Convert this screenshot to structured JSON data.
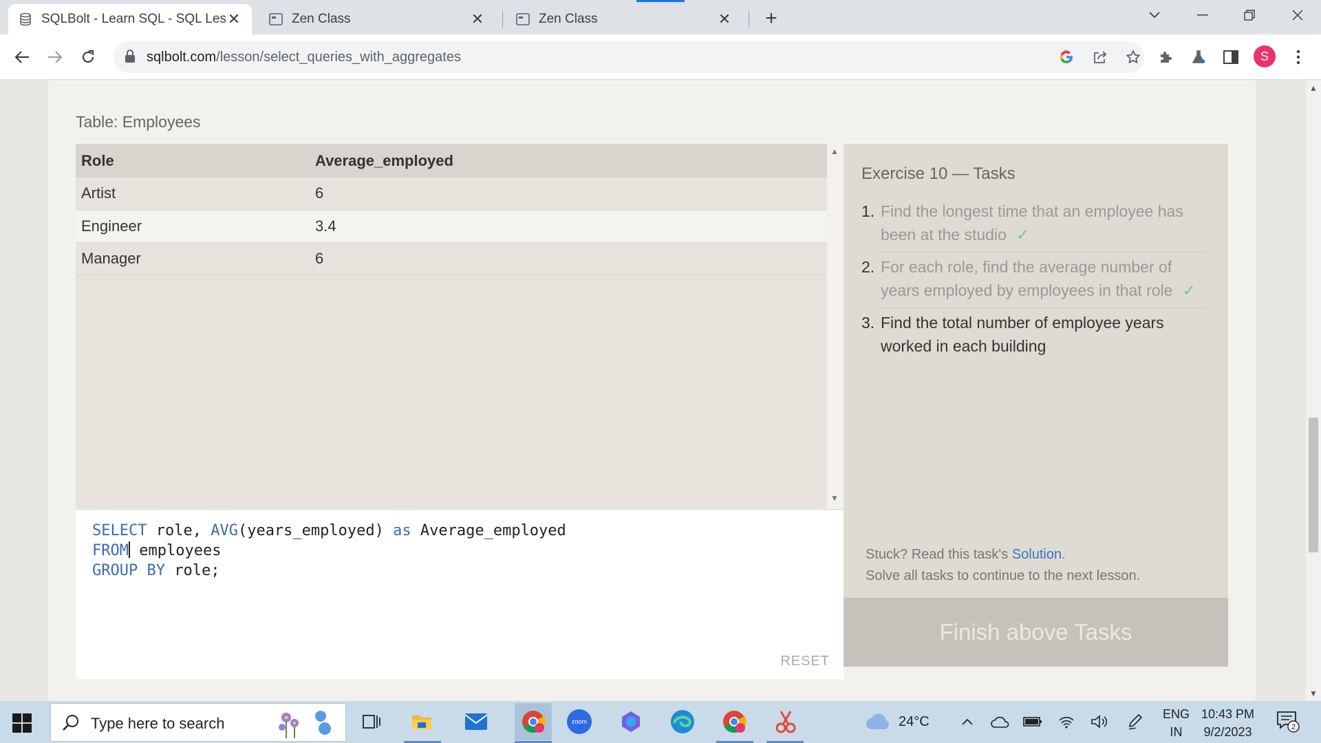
{
  "browser": {
    "tabs": [
      {
        "title": "SQLBolt - Learn SQL - SQL Lesso",
        "active": true
      },
      {
        "title": "Zen Class",
        "active": false
      },
      {
        "title": "Zen Class",
        "active": false
      }
    ],
    "url_host": "sqlbolt.com",
    "url_path": "/lesson/select_queries_with_aggregates",
    "profile_initial": "S",
    "profile_color": "#e8336d"
  },
  "page": {
    "table_label": "Table: Employees",
    "result": {
      "headers": [
        "Role",
        "Average_employed"
      ],
      "rows": [
        [
          "Artist",
          "6"
        ],
        [
          "Engineer",
          "3.4"
        ],
        [
          "Manager",
          "6"
        ]
      ]
    },
    "editor": {
      "line1": {
        "kw1": "SELECT",
        "t1": " role, ",
        "kw2": "AVG",
        "t2": "(years_employed) ",
        "kw3": "as",
        "t3": " Average_employed"
      },
      "line2": {
        "kw1": "FROM",
        "t1": " employees"
      },
      "line3": {
        "kw1": "GROUP BY",
        "t1": " role;"
      },
      "reset_label": "RESET"
    },
    "exercise": {
      "title": "Exercise 10 — Tasks",
      "tasks": [
        {
          "num": "1.",
          "line1": "Find the longest time that an employee has",
          "line2": "been at the studio",
          "done": true
        },
        {
          "num": "2.",
          "line1": "For each role, find the average number of",
          "line2": "years employed by employees in that role",
          "done": true
        },
        {
          "num": "3.",
          "line1": "Find the total number of employee years",
          "line2": "worked in each building",
          "done": false
        }
      ],
      "check_mark": "✓",
      "stuck_prefix": "Stuck? Read this task's ",
      "solution_link": "Solution",
      "stuck_suffix": ".",
      "solve_all": "Solve all tasks to continue to the next lesson.",
      "finish_button": "Finish above Tasks"
    }
  },
  "taskbar": {
    "search_placeholder": "Type here to search",
    "weather": "24°C",
    "lang_line1": "ENG",
    "lang_line2": "IN",
    "time": "10:43 PM",
    "date": "9/2/2023",
    "notification_count": "2"
  }
}
